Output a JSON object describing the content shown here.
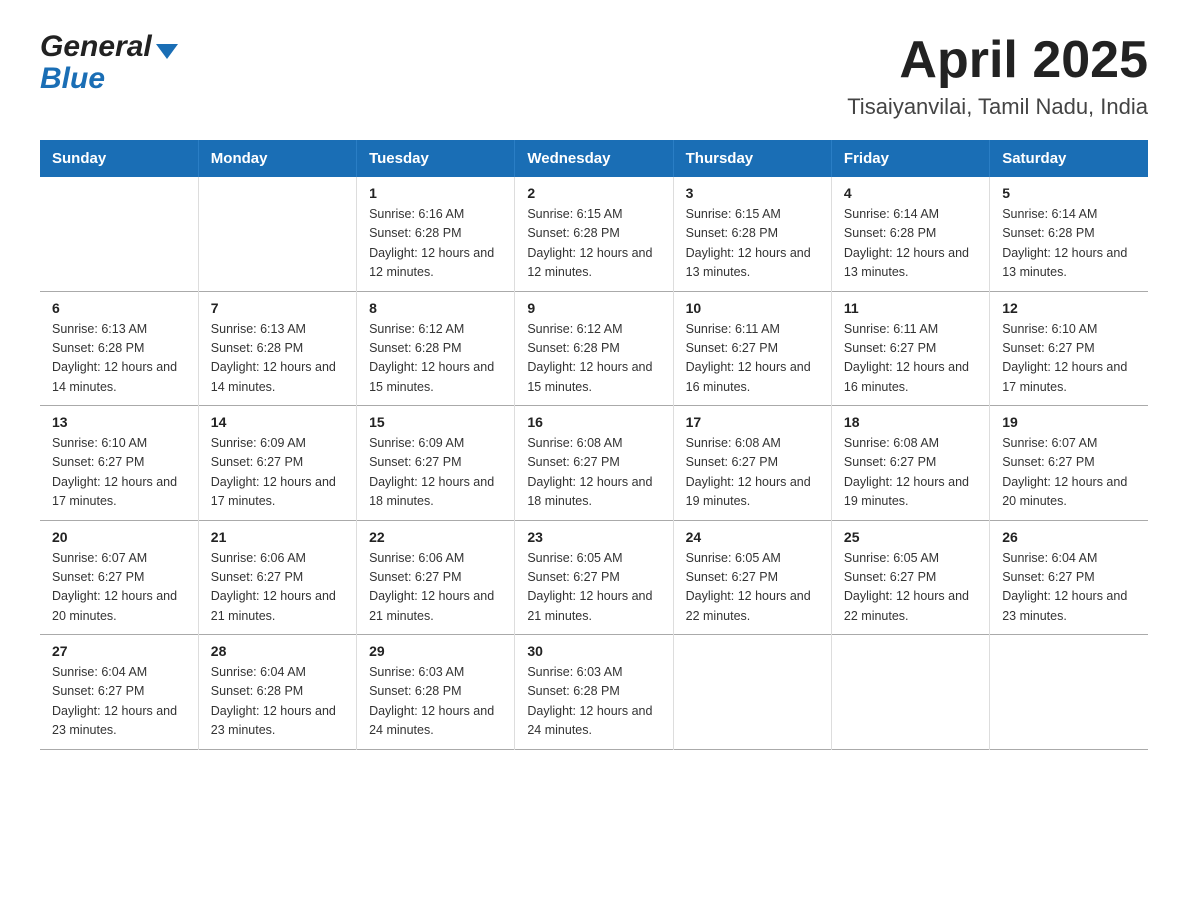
{
  "header": {
    "title": "April 2025",
    "subtitle": "Tisaiyanvilai, Tamil Nadu, India",
    "logo_general": "General",
    "logo_blue": "Blue"
  },
  "days_of_week": [
    "Sunday",
    "Monday",
    "Tuesday",
    "Wednesday",
    "Thursday",
    "Friday",
    "Saturday"
  ],
  "weeks": [
    [
      {
        "day": "",
        "sunrise": "",
        "sunset": "",
        "daylight": ""
      },
      {
        "day": "",
        "sunrise": "",
        "sunset": "",
        "daylight": ""
      },
      {
        "day": "1",
        "sunrise": "Sunrise: 6:16 AM",
        "sunset": "Sunset: 6:28 PM",
        "daylight": "Daylight: 12 hours and 12 minutes."
      },
      {
        "day": "2",
        "sunrise": "Sunrise: 6:15 AM",
        "sunset": "Sunset: 6:28 PM",
        "daylight": "Daylight: 12 hours and 12 minutes."
      },
      {
        "day": "3",
        "sunrise": "Sunrise: 6:15 AM",
        "sunset": "Sunset: 6:28 PM",
        "daylight": "Daylight: 12 hours and 13 minutes."
      },
      {
        "day": "4",
        "sunrise": "Sunrise: 6:14 AM",
        "sunset": "Sunset: 6:28 PM",
        "daylight": "Daylight: 12 hours and 13 minutes."
      },
      {
        "day": "5",
        "sunrise": "Sunrise: 6:14 AM",
        "sunset": "Sunset: 6:28 PM",
        "daylight": "Daylight: 12 hours and 13 minutes."
      }
    ],
    [
      {
        "day": "6",
        "sunrise": "Sunrise: 6:13 AM",
        "sunset": "Sunset: 6:28 PM",
        "daylight": "Daylight: 12 hours and 14 minutes."
      },
      {
        "day": "7",
        "sunrise": "Sunrise: 6:13 AM",
        "sunset": "Sunset: 6:28 PM",
        "daylight": "Daylight: 12 hours and 14 minutes."
      },
      {
        "day": "8",
        "sunrise": "Sunrise: 6:12 AM",
        "sunset": "Sunset: 6:28 PM",
        "daylight": "Daylight: 12 hours and 15 minutes."
      },
      {
        "day": "9",
        "sunrise": "Sunrise: 6:12 AM",
        "sunset": "Sunset: 6:28 PM",
        "daylight": "Daylight: 12 hours and 15 minutes."
      },
      {
        "day": "10",
        "sunrise": "Sunrise: 6:11 AM",
        "sunset": "Sunset: 6:27 PM",
        "daylight": "Daylight: 12 hours and 16 minutes."
      },
      {
        "day": "11",
        "sunrise": "Sunrise: 6:11 AM",
        "sunset": "Sunset: 6:27 PM",
        "daylight": "Daylight: 12 hours and 16 minutes."
      },
      {
        "day": "12",
        "sunrise": "Sunrise: 6:10 AM",
        "sunset": "Sunset: 6:27 PM",
        "daylight": "Daylight: 12 hours and 17 minutes."
      }
    ],
    [
      {
        "day": "13",
        "sunrise": "Sunrise: 6:10 AM",
        "sunset": "Sunset: 6:27 PM",
        "daylight": "Daylight: 12 hours and 17 minutes."
      },
      {
        "day": "14",
        "sunrise": "Sunrise: 6:09 AM",
        "sunset": "Sunset: 6:27 PM",
        "daylight": "Daylight: 12 hours and 17 minutes."
      },
      {
        "day": "15",
        "sunrise": "Sunrise: 6:09 AM",
        "sunset": "Sunset: 6:27 PM",
        "daylight": "Daylight: 12 hours and 18 minutes."
      },
      {
        "day": "16",
        "sunrise": "Sunrise: 6:08 AM",
        "sunset": "Sunset: 6:27 PM",
        "daylight": "Daylight: 12 hours and 18 minutes."
      },
      {
        "day": "17",
        "sunrise": "Sunrise: 6:08 AM",
        "sunset": "Sunset: 6:27 PM",
        "daylight": "Daylight: 12 hours and 19 minutes."
      },
      {
        "day": "18",
        "sunrise": "Sunrise: 6:08 AM",
        "sunset": "Sunset: 6:27 PM",
        "daylight": "Daylight: 12 hours and 19 minutes."
      },
      {
        "day": "19",
        "sunrise": "Sunrise: 6:07 AM",
        "sunset": "Sunset: 6:27 PM",
        "daylight": "Daylight: 12 hours and 20 minutes."
      }
    ],
    [
      {
        "day": "20",
        "sunrise": "Sunrise: 6:07 AM",
        "sunset": "Sunset: 6:27 PM",
        "daylight": "Daylight: 12 hours and 20 minutes."
      },
      {
        "day": "21",
        "sunrise": "Sunrise: 6:06 AM",
        "sunset": "Sunset: 6:27 PM",
        "daylight": "Daylight: 12 hours and 21 minutes."
      },
      {
        "day": "22",
        "sunrise": "Sunrise: 6:06 AM",
        "sunset": "Sunset: 6:27 PM",
        "daylight": "Daylight: 12 hours and 21 minutes."
      },
      {
        "day": "23",
        "sunrise": "Sunrise: 6:05 AM",
        "sunset": "Sunset: 6:27 PM",
        "daylight": "Daylight: 12 hours and 21 minutes."
      },
      {
        "day": "24",
        "sunrise": "Sunrise: 6:05 AM",
        "sunset": "Sunset: 6:27 PM",
        "daylight": "Daylight: 12 hours and 22 minutes."
      },
      {
        "day": "25",
        "sunrise": "Sunrise: 6:05 AM",
        "sunset": "Sunset: 6:27 PM",
        "daylight": "Daylight: 12 hours and 22 minutes."
      },
      {
        "day": "26",
        "sunrise": "Sunrise: 6:04 AM",
        "sunset": "Sunset: 6:27 PM",
        "daylight": "Daylight: 12 hours and 23 minutes."
      }
    ],
    [
      {
        "day": "27",
        "sunrise": "Sunrise: 6:04 AM",
        "sunset": "Sunset: 6:27 PM",
        "daylight": "Daylight: 12 hours and 23 minutes."
      },
      {
        "day": "28",
        "sunrise": "Sunrise: 6:04 AM",
        "sunset": "Sunset: 6:28 PM",
        "daylight": "Daylight: 12 hours and 23 minutes."
      },
      {
        "day": "29",
        "sunrise": "Sunrise: 6:03 AM",
        "sunset": "Sunset: 6:28 PM",
        "daylight": "Daylight: 12 hours and 24 minutes."
      },
      {
        "day": "30",
        "sunrise": "Sunrise: 6:03 AM",
        "sunset": "Sunset: 6:28 PM",
        "daylight": "Daylight: 12 hours and 24 minutes."
      },
      {
        "day": "",
        "sunrise": "",
        "sunset": "",
        "daylight": ""
      },
      {
        "day": "",
        "sunrise": "",
        "sunset": "",
        "daylight": ""
      },
      {
        "day": "",
        "sunrise": "",
        "sunset": "",
        "daylight": ""
      }
    ]
  ]
}
